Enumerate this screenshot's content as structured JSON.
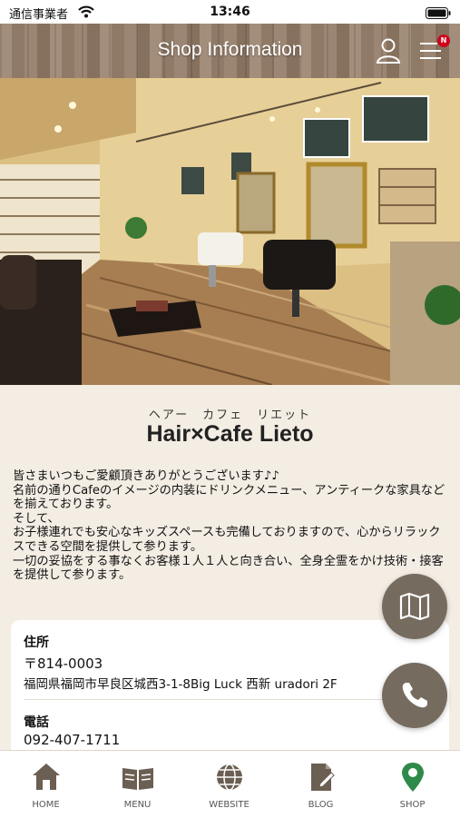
{
  "status_bar": {
    "carrier": "通信事業者",
    "time": "13:46"
  },
  "header": {
    "title": "Shop Information",
    "notification_badge": "N"
  },
  "shop": {
    "kana": "ヘアー　カフェ　リエット",
    "name": "Hair×Cafe Lieto",
    "description": "皆さまいつもご愛顧頂きありがとうございます♪♪\n名前の通りCafeのイメージの内装にドリンクメニュー、アンティークな家具などを揃えております。\nそして、\nお子様連れでも安心なキッズスペースも完備しておりますので、心からリラックスできる空間を提供して参ります。\n一切の妥協をする事なくお客様１人１人と向き合い、全身全霊をかけ技術・接客を提供して参ります。"
  },
  "info": {
    "address_label": "住所",
    "postal_code": "〒814-0003",
    "address": "福岡県福岡市早良区城西3-1-8Big Luck 西新 uradori 2F",
    "phone_label": "電話",
    "phone": "092-407-1711"
  },
  "tabs": [
    {
      "label": "HOME",
      "icon": "home-icon"
    },
    {
      "label": "MENU",
      "icon": "book-icon"
    },
    {
      "label": "WEBSITE",
      "icon": "globe-icon"
    },
    {
      "label": "BLOG",
      "icon": "blog-icon"
    },
    {
      "label": "SHOP",
      "icon": "map-pin-icon",
      "active": true
    }
  ],
  "colors": {
    "background": "#f3ede4",
    "fab": "#766b5f",
    "tab_icon": "#6b5e52",
    "tab_active": "#2f8a4a",
    "badge": "#d0021b"
  }
}
